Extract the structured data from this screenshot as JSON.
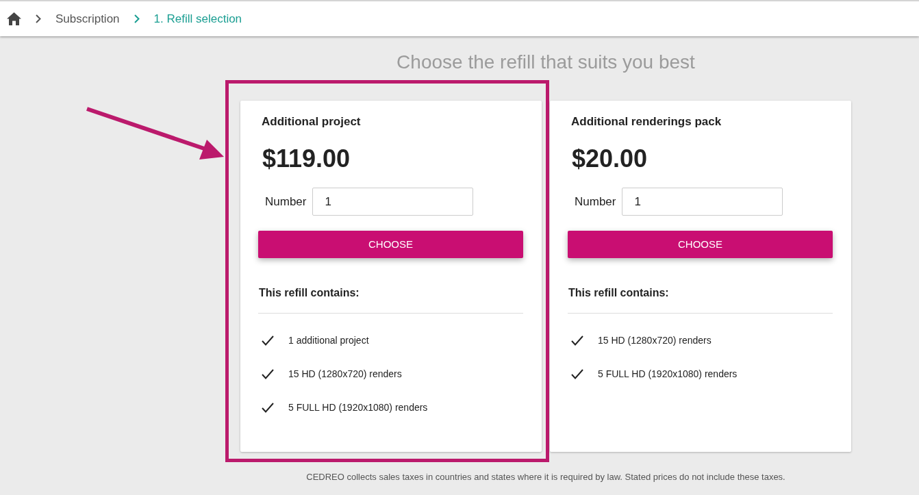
{
  "breadcrumb": [
    {
      "kind": "home",
      "selected": false
    },
    {
      "kind": "link",
      "label": "Subscription",
      "selected": false
    },
    {
      "kind": "link",
      "label": "1. Refill selection",
      "selected": true
    }
  ],
  "page_title": "Choose the refill that suits you best",
  "cards": [
    {
      "title": "Additional project",
      "price": "$119.00",
      "quantity": {
        "label": "Number",
        "value": "1"
      },
      "button": "CHOOSE",
      "contents_title": "This refill contains:",
      "items": [
        "1 additional project",
        "15 HD (1280x720) renders",
        "5 FULL HD (1920x1080) renders"
      ],
      "highlighted": true
    },
    {
      "title": "Additional renderings pack",
      "price": "$20.00",
      "quantity": {
        "label": "Number",
        "value": "1"
      },
      "button": "CHOOSE",
      "contents_title": "This refill contains:",
      "items": [
        "15 HD (1280x720) renders",
        "5 FULL HD (1920x1080) renders"
      ],
      "highlighted": false
    }
  ],
  "footer_note": "CEDREO collects sales taxes in countries and states where it is required by law. Stated prices do not include these taxes."
}
